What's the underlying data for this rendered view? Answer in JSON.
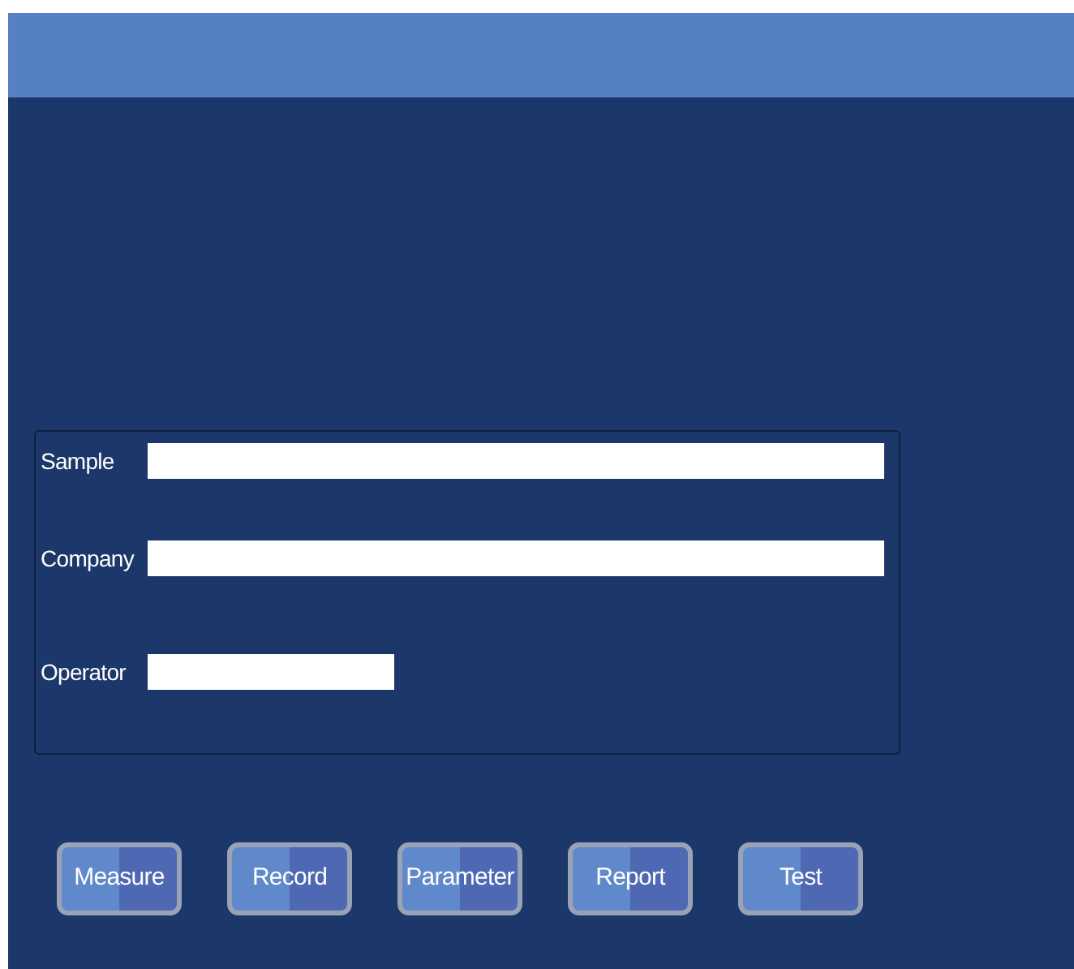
{
  "fields": [
    {
      "label": "Sample",
      "kind": "wide"
    },
    {
      "label": "Company",
      "kind": "wide"
    },
    {
      "label": "Operator",
      "kind": "short"
    }
  ],
  "buttons": [
    "Measure",
    "Record",
    "Parameter",
    "Report",
    "Test"
  ]
}
